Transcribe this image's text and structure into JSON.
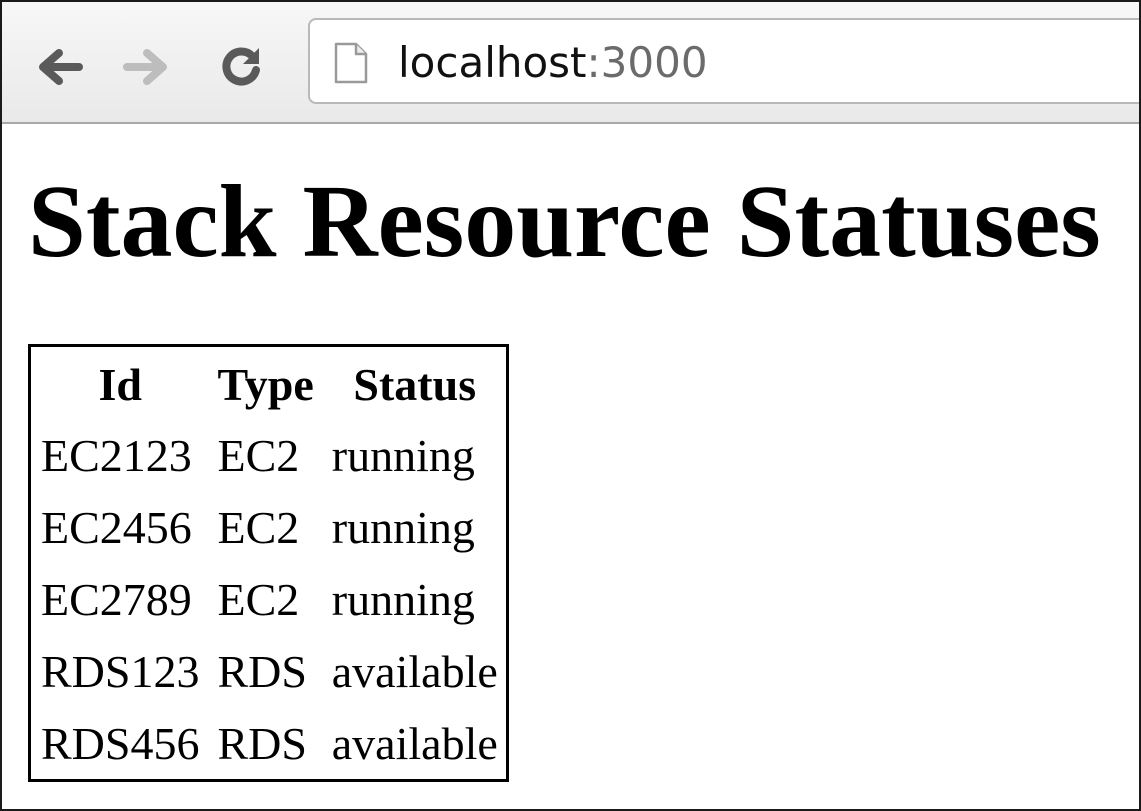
{
  "browser": {
    "url_host": "localhost",
    "url_port": ":3000",
    "icons": {
      "back": "arrow-left",
      "forward": "arrow-right",
      "reload": "reload",
      "page": "page-document"
    }
  },
  "page": {
    "title": "Stack Resource Statuses",
    "table": {
      "headers": [
        "Id",
        "Type",
        "Status"
      ],
      "rows": [
        [
          "EC2123",
          "EC2",
          "running"
        ],
        [
          "EC2456",
          "EC2",
          "running"
        ],
        [
          "EC2789",
          "EC2",
          "running"
        ],
        [
          "RDS123",
          "RDS",
          "available"
        ],
        [
          "RDS456",
          "RDS",
          "available"
        ]
      ]
    }
  }
}
